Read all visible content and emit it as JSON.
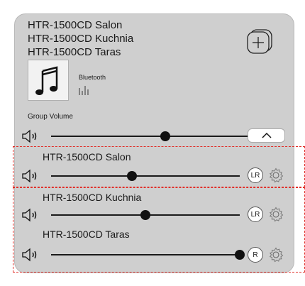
{
  "group": {
    "names": [
      "HTR-1500CD Salon",
      "HTR-1500CD Kuchnia",
      "HTR-1500CD Taras"
    ],
    "add_icon": "add-to-group-icon"
  },
  "now_playing": {
    "art_icon": "music-note-icon",
    "source": "Bluetooth",
    "eq_icon": "equalizer-icon"
  },
  "group_volume": {
    "label": "Group Volume",
    "level": 0.53,
    "collapse_icon": "chevron-up-icon"
  },
  "rooms": [
    {
      "name": "HTR-1500CD Salon",
      "level": 0.43,
      "channel": "LR"
    },
    {
      "name": "HTR-1500CD Kuchnia",
      "level": 0.5,
      "channel": "LR"
    },
    {
      "name": "HTR-1500CD Taras",
      "level": 1.0,
      "channel": "R"
    }
  ],
  "colors": {
    "card": "#cfcfcf",
    "highlight_dash": "#e0302a"
  }
}
